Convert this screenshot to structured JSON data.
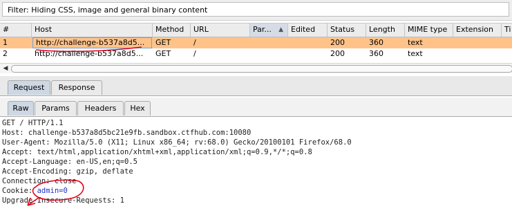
{
  "filter": {
    "text": "Filter: Hiding CSS, image and general binary content"
  },
  "table": {
    "columns": [
      "#",
      "Host",
      "Method",
      "URL",
      "Par...",
      "Edited",
      "Status",
      "Length",
      "MIME type",
      "Extension",
      "Ti"
    ],
    "rows": [
      {
        "num": "1",
        "host": "http://challenge-b537a8d5...",
        "method": "GET",
        "url": "/",
        "status": "200",
        "length": "360",
        "mime": "text"
      },
      {
        "num": "2",
        "host": "http://challenge-b537a8d5...",
        "method": "GET",
        "url": "/",
        "status": "200",
        "length": "360",
        "mime": "text"
      }
    ],
    "selected_row": 1
  },
  "tabs": {
    "request": "Request",
    "response": "Response"
  },
  "subtabs": {
    "raw": "Raw",
    "params": "Params",
    "headers": "Headers",
    "hex": "Hex"
  },
  "request_lines": {
    "l1": "GET / HTTP/1.1",
    "l2": "Host: challenge-b537a8d5bc21e9fb.sandbox.ctfhub.com:10080",
    "l3": "User-Agent: Mozilla/5.0 (X11; Linux x86_64; rv:68.0) Gecko/20100101 Firefox/68.0",
    "l4": "Accept: text/html,application/xhtml+xml,application/xml;q=0.9,*/*;q=0.8",
    "l5": "Accept-Language: en-US,en;q=0.5",
    "l6": "Accept-Encoding: gzip, deflate",
    "l7": "Connection: close",
    "l8_key": "Cookie: ",
    "l8_val": "admin=0",
    "l9": "Upgrade-Insecure-Requests: 1"
  },
  "colors": {
    "selected_row": "#ffc38a",
    "annotation": "#e0001a",
    "cookie_value": "#2233cc"
  }
}
